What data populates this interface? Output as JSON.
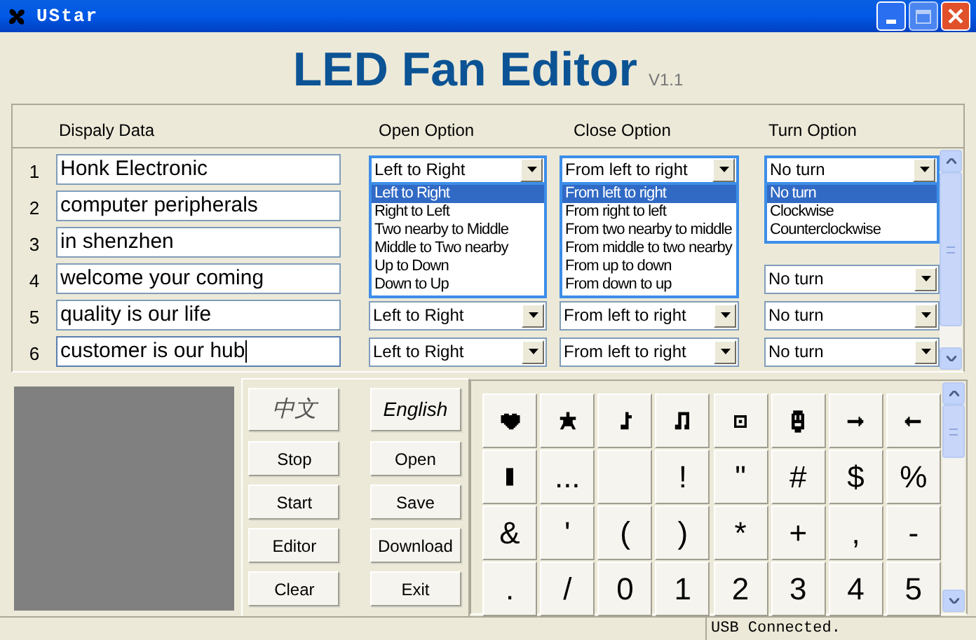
{
  "window": {
    "title": "UStar"
  },
  "header": {
    "title": "LED Fan Editor",
    "version": "V1.1"
  },
  "columns": [
    "Dispaly Data",
    "Open Option",
    "Close Option",
    "Turn Option"
  ],
  "rows": [
    {
      "number": "1",
      "text": "Honk Electronic",
      "focused": false,
      "open": {
        "value": "Left to Right",
        "expanded": true,
        "options": [
          {
            "label": "Left to Right",
            "selected": true
          },
          {
            "label": "Right to Left",
            "selected": false
          },
          {
            "label": "Two nearby to Middle",
            "selected": false
          },
          {
            "label": "Middle to Two nearby",
            "selected": false
          },
          {
            "label": "Up to Down",
            "selected": false
          },
          {
            "label": "Down to Up",
            "selected": false
          }
        ]
      },
      "close": {
        "value": "From left to right",
        "expanded": true,
        "options": [
          {
            "label": "From left to right",
            "selected": true
          },
          {
            "label": "From right to left",
            "selected": false
          },
          {
            "label": "From two nearby to middle",
            "selected": false
          },
          {
            "label": "From middle to two nearby",
            "selected": false
          },
          {
            "label": "From up to down",
            "selected": false
          },
          {
            "label": "From down to up",
            "selected": false
          }
        ]
      },
      "turn": {
        "value": "No turn",
        "expanded": true,
        "options": [
          {
            "label": "No turn",
            "selected": true
          },
          {
            "label": "Clockwise",
            "selected": false
          },
          {
            "label": "Counterclockwise",
            "selected": false
          }
        ]
      }
    },
    {
      "number": "2",
      "text": "computer peripherals",
      "focused": false
    },
    {
      "number": "3",
      "text": "in shenzhen",
      "focused": false
    },
    {
      "number": "4",
      "text": "welcome your coming",
      "focused": false,
      "turn": {
        "value": "No turn",
        "expanded": false
      }
    },
    {
      "number": "5",
      "text": "quality is our life",
      "focused": false,
      "open": {
        "value": "Left to Right",
        "expanded": false
      },
      "close": {
        "value": "From left to right",
        "expanded": false
      },
      "turn": {
        "value": "No turn",
        "expanded": false
      }
    },
    {
      "number": "6",
      "text": "customer is our hub",
      "focused": true,
      "open": {
        "value": "Left to Right",
        "expanded": false
      },
      "close": {
        "value": "From left to right",
        "expanded": false
      },
      "turn": {
        "value": "No turn",
        "expanded": false
      }
    }
  ],
  "buttons": [
    {
      "label": "中文",
      "kind": "chinese"
    },
    {
      "label": "English",
      "kind": "english"
    },
    {
      "label": "Stop",
      "kind": "plain"
    },
    {
      "label": "Open",
      "kind": "plain"
    },
    {
      "label": "Start",
      "kind": "plain"
    },
    {
      "label": "Save",
      "kind": "plain"
    },
    {
      "label": "Editor",
      "kind": "plain"
    },
    {
      "label": "Download",
      "kind": "plain"
    },
    {
      "label": "Clear",
      "kind": "plain"
    },
    {
      "label": "Exit",
      "kind": "plain"
    }
  ],
  "keypad": [
    {
      "kind": "heart"
    },
    {
      "kind": "figure"
    },
    {
      "kind": "note"
    },
    {
      "kind": "notes"
    },
    {
      "kind": "target"
    },
    {
      "kind": "robot"
    },
    {
      "kind": "rightarrow"
    },
    {
      "kind": "leftarrow"
    },
    {
      "kind": "block"
    },
    {
      "kind": "char",
      "label": "..."
    },
    {
      "kind": "blank"
    },
    {
      "kind": "char",
      "label": "!"
    },
    {
      "kind": "char",
      "label": "\""
    },
    {
      "kind": "char",
      "label": "#"
    },
    {
      "kind": "char",
      "label": "$"
    },
    {
      "kind": "char",
      "label": "%"
    },
    {
      "kind": "char",
      "label": "&"
    },
    {
      "kind": "char",
      "label": "'"
    },
    {
      "kind": "char",
      "label": "("
    },
    {
      "kind": "char",
      "label": ")"
    },
    {
      "kind": "char",
      "label": "*"
    },
    {
      "kind": "char",
      "label": "+"
    },
    {
      "kind": "char",
      "label": ","
    },
    {
      "kind": "char",
      "label": "-"
    },
    {
      "kind": "char",
      "label": "."
    },
    {
      "kind": "char",
      "label": "/"
    },
    {
      "kind": "char",
      "label": "0"
    },
    {
      "kind": "char",
      "label": "1"
    },
    {
      "kind": "char",
      "label": "2"
    },
    {
      "kind": "char",
      "label": "3"
    },
    {
      "kind": "char",
      "label": "4"
    },
    {
      "kind": "char",
      "label": "5"
    }
  ],
  "status_bar": {
    "message": "USB Connected."
  }
}
